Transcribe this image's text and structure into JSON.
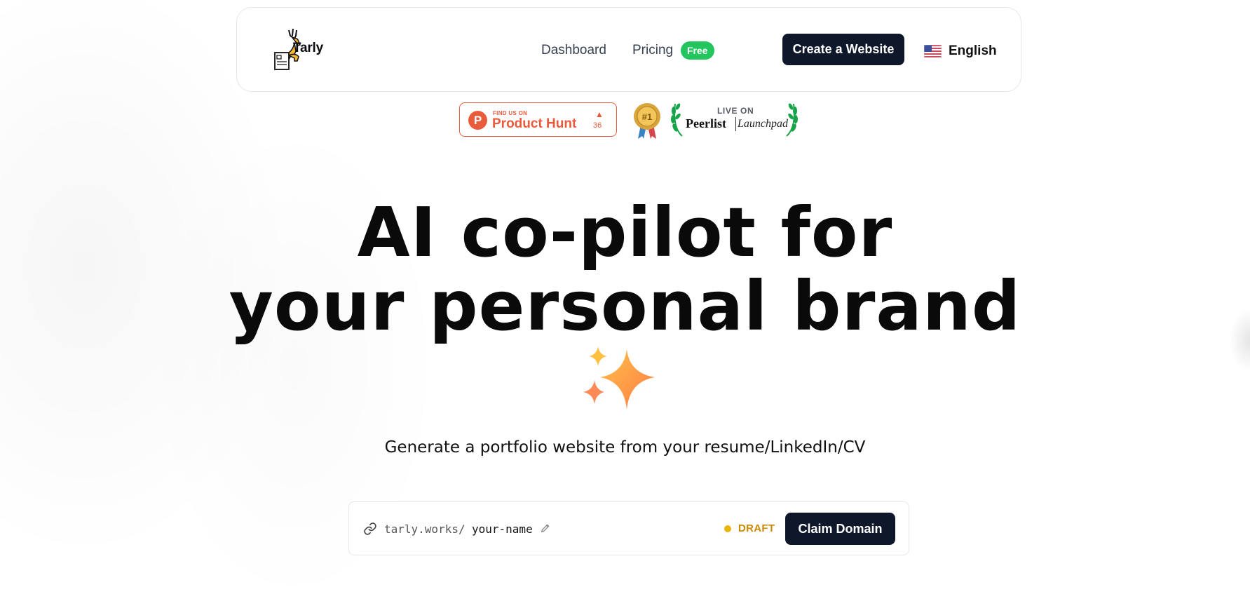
{
  "brand": {
    "name": "Tarly"
  },
  "nav": {
    "dashboard_label": "Dashboard",
    "pricing_label": "Pricing",
    "pricing_badge": "Free",
    "cta_label": "Create a Website",
    "language_label": "English"
  },
  "badges": {
    "product_hunt": {
      "small": "FIND US ON",
      "name": "Product Hunt",
      "votes": "36"
    },
    "medal_text": "#1",
    "peerlist": {
      "live": "LIVE ON",
      "name": "Peerlist",
      "launchpad": "Launchpad"
    }
  },
  "hero": {
    "line1": "AI co-pilot for",
    "line2": "your personal brand",
    "subtitle": "Generate a portfolio website from your resume/LinkedIn/CV"
  },
  "domain": {
    "prefix": "tarly.works/",
    "value": "your-name",
    "status": "DRAFT",
    "claim_label": "Claim Domain"
  },
  "colors": {
    "primary": "#0f172a",
    "free_badge": "#22c55e",
    "product_hunt": "#ea5b3c",
    "draft": "#ca8a04"
  },
  "icons": [
    "deer-logo-icon",
    "us-flag-icon",
    "product-hunt-logo-icon",
    "upvote-triangle-icon",
    "medal-icon",
    "laurel-icon",
    "sparkles-icon",
    "link-icon",
    "pencil-icon"
  ]
}
